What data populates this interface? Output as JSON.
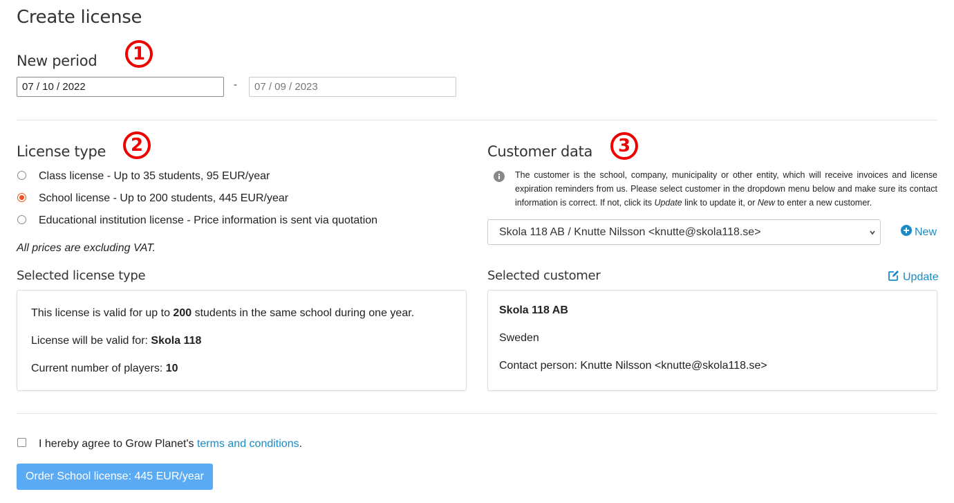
{
  "page": {
    "title": "Create license"
  },
  "period": {
    "heading": "New period",
    "badge": "1",
    "start_date": "07 / 10 / 2022",
    "separator": "-",
    "end_date": "07 / 09 / 2023"
  },
  "license_type": {
    "heading": "License type",
    "badge": "2",
    "options": [
      {
        "label": "Class license - Up to 35 students, 95 EUR/year",
        "checked": false
      },
      {
        "label": "School license - Up to 200 students, 445 EUR/year",
        "checked": true
      },
      {
        "label": "Educational institution license - Price information is sent via quotation",
        "checked": false
      }
    ],
    "note": "All prices are excluding VAT."
  },
  "selected_license": {
    "heading": "Selected license type",
    "line1_pre": "This license is valid for up to ",
    "line1_bold": "200",
    "line1_post": " students in the same school during one year.",
    "line2_pre": "License will be valid for: ",
    "line2_bold": "Skola 118",
    "line3_pre": "Current number of players: ",
    "line3_bold": "10"
  },
  "customer": {
    "heading": "Customer data",
    "badge": "3",
    "info_p1": "The customer is the school, company, municipality or other entity, which will receive invoices and license expiration reminders from us. Please select customer in the dropdown menu below and make sure its contact information is correct. If not, click its ",
    "info_update": "Update",
    "info_p2": " link to update it, or ",
    "info_new": "New",
    "info_p3": " to enter a new customer.",
    "select_value": "Skola 118 AB / Knutte Nilsson <knutte@skola118.se>",
    "new_label": "New"
  },
  "selected_customer": {
    "heading": "Selected customer",
    "update_label": "Update",
    "name": "Skola 118 AB",
    "country": "Sweden",
    "contact": "Contact person: Knutte Nilsson <knutte@skola118.se>"
  },
  "agreement": {
    "text_pre": "I hereby agree to Grow Planet's ",
    "link": "terms and conditions",
    "text_post": "."
  },
  "order_button": {
    "label": "Order School license: 445 EUR/year"
  },
  "colors": {
    "accent": "#e95420",
    "link": "#1a8bc6",
    "button": "#5aabf3",
    "badge": "#e00000"
  }
}
